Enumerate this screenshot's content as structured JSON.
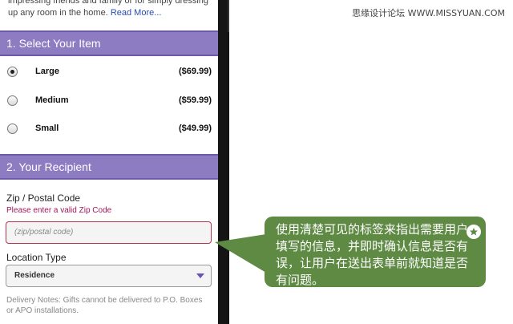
{
  "watermark": "思缘设计论坛 WWW.MISSYUAN.COM",
  "intro": {
    "text": "impressing friends and family or for simply dressing up any room in the home.",
    "link": "Read More..."
  },
  "section1": {
    "title": "1. Select Your Item",
    "items": [
      {
        "label": "Large",
        "price": "($69.99)",
        "selected": true
      },
      {
        "label": "Medium",
        "price": "($59.99)",
        "selected": false
      },
      {
        "label": "Small",
        "price": "($49.99)",
        "selected": false
      }
    ]
  },
  "section2": {
    "title": "2. Your Recipient",
    "zip_label": "Zip / Postal Code",
    "zip_error": "Please enter a valid Zip Code",
    "zip_placeholder": "(zip/postal code)",
    "location_label": "Location Type",
    "location_value": "Residence",
    "delivery_note": "Delivery Notes: Gifts cannot be delivered to P.O. Boxes or APO installations."
  },
  "callout": {
    "text": "使用清楚可见的标签来指出需要用户填写的信息，并即时确认信息是否有误，让用户在送出表单前就知道是否有问题。",
    "color": "#5e8a44",
    "icon": "star-icon"
  },
  "colors": {
    "section_bar": "#8e7cc3",
    "error": "#a3155a",
    "link": "#2b4bb6"
  }
}
